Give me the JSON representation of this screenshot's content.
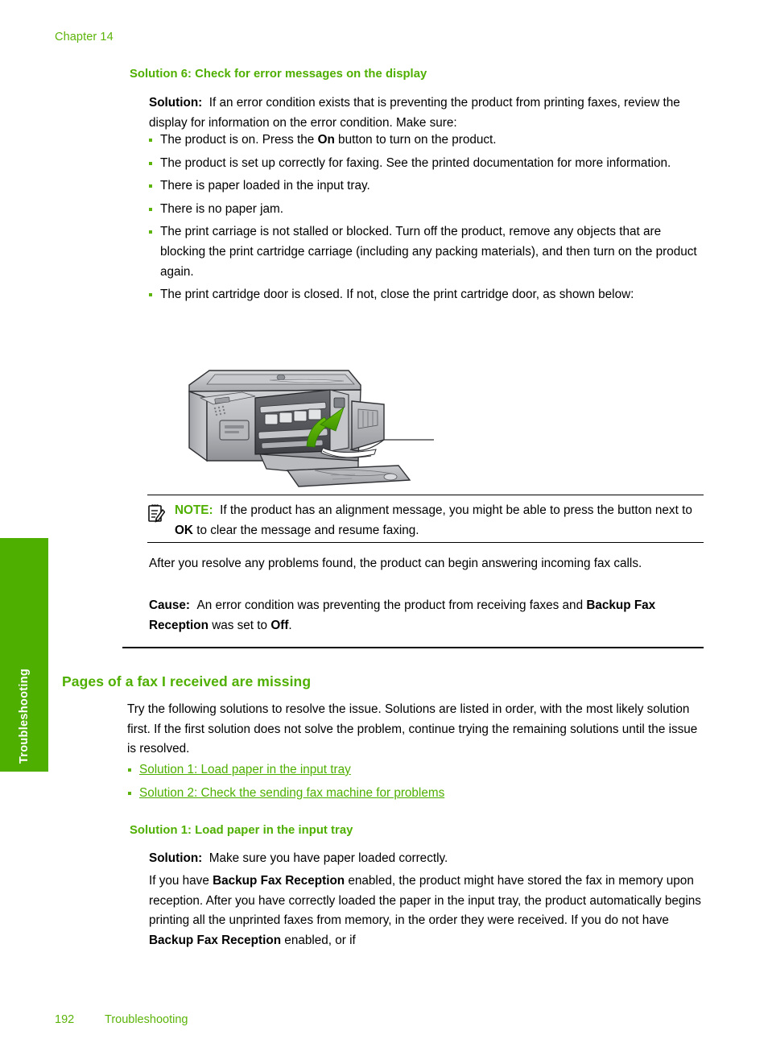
{
  "header": {
    "chapter": "Chapter 14"
  },
  "side_tab": {
    "label": "Troubleshooting",
    "color": "#4FAF00"
  },
  "colors": {
    "green_heading": "#4FAF00",
    "green_accent": "#5CB40A",
    "link_green": "#4FAF00",
    "white": "#FFFFFF",
    "black": "#000000"
  },
  "section_solution6": {
    "heading": "Solution 6: Check for error messages on the display",
    "solution_label": "Solution:",
    "solution_body": "If an error condition exists that is preventing the product from printing faxes, review the display for information on the error condition. Make sure:",
    "bullets": [
      {
        "pre": "The product is on. Press the ",
        "bold": "On",
        "post": " button to turn on the product."
      },
      {
        "pre": "The product is set up correctly for faxing. See the printed documentation for more information.",
        "bold": "",
        "post": ""
      },
      {
        "pre": "There is paper loaded in the input tray.",
        "bold": "",
        "post": ""
      },
      {
        "pre": "There is no paper jam.",
        "bold": "",
        "post": ""
      },
      {
        "pre": "The print carriage is not stalled or blocked. Turn off the product, remove any objects that are blocking the print cartridge carriage (including any packing materials), and then turn on the product again.",
        "bold": "",
        "post": ""
      },
      {
        "pre": "The print cartridge door is closed. If not, close the print cartridge door, as shown below:",
        "bold": "",
        "post": ""
      }
    ],
    "figure_alt": "HP All-in-One printer with print cartridge door open and a green arrow showing the door being closed",
    "note": {
      "icon": "note-clipboard-pencil-icon",
      "label": "NOTE:",
      "text_pre": "If the product has an alignment message, you might be able to press the button next to ",
      "text_bold": "OK",
      "text_post": " to clear the message and resume faxing."
    },
    "after_para": "After you resolve any problems found, the product can begin answering incoming fax calls.",
    "cause_label": "Cause:",
    "cause_pre": "An error condition was preventing the product from receiving faxes and ",
    "cause_bold1": "Backup Fax Reception",
    "cause_mid": " was set to ",
    "cause_bold2": "Off",
    "cause_post": "."
  },
  "section_pages_missing": {
    "heading": "Pages of a fax I received are missing",
    "intro": "Try the following solutions to resolve the issue. Solutions are listed in order, with the most likely solution first. If the first solution does not solve the problem, continue trying the remaining solutions until the issue is resolved.",
    "links": [
      "Solution 1: Load paper in the input tray",
      "Solution 2: Check the sending fax machine for problems"
    ]
  },
  "section_solution1": {
    "heading": "Solution 1: Load paper in the input tray",
    "solution_label": "Solution:",
    "solution_body": "Make sure you have paper loaded correctly.",
    "body_pre": "If you have ",
    "body_bold1": "Backup Fax Reception",
    "body_mid1": " enabled, the product might have stored the fax in memory upon reception. After you have correctly loaded the paper in the input tray, the product automatically begins printing all the unprinted faxes from memory, in the order they were received. If you do not have ",
    "body_bold2": "Backup Fax Reception",
    "body_post": " enabled, or if"
  },
  "footer": {
    "page_number": "192",
    "section_name": "Troubleshooting"
  }
}
